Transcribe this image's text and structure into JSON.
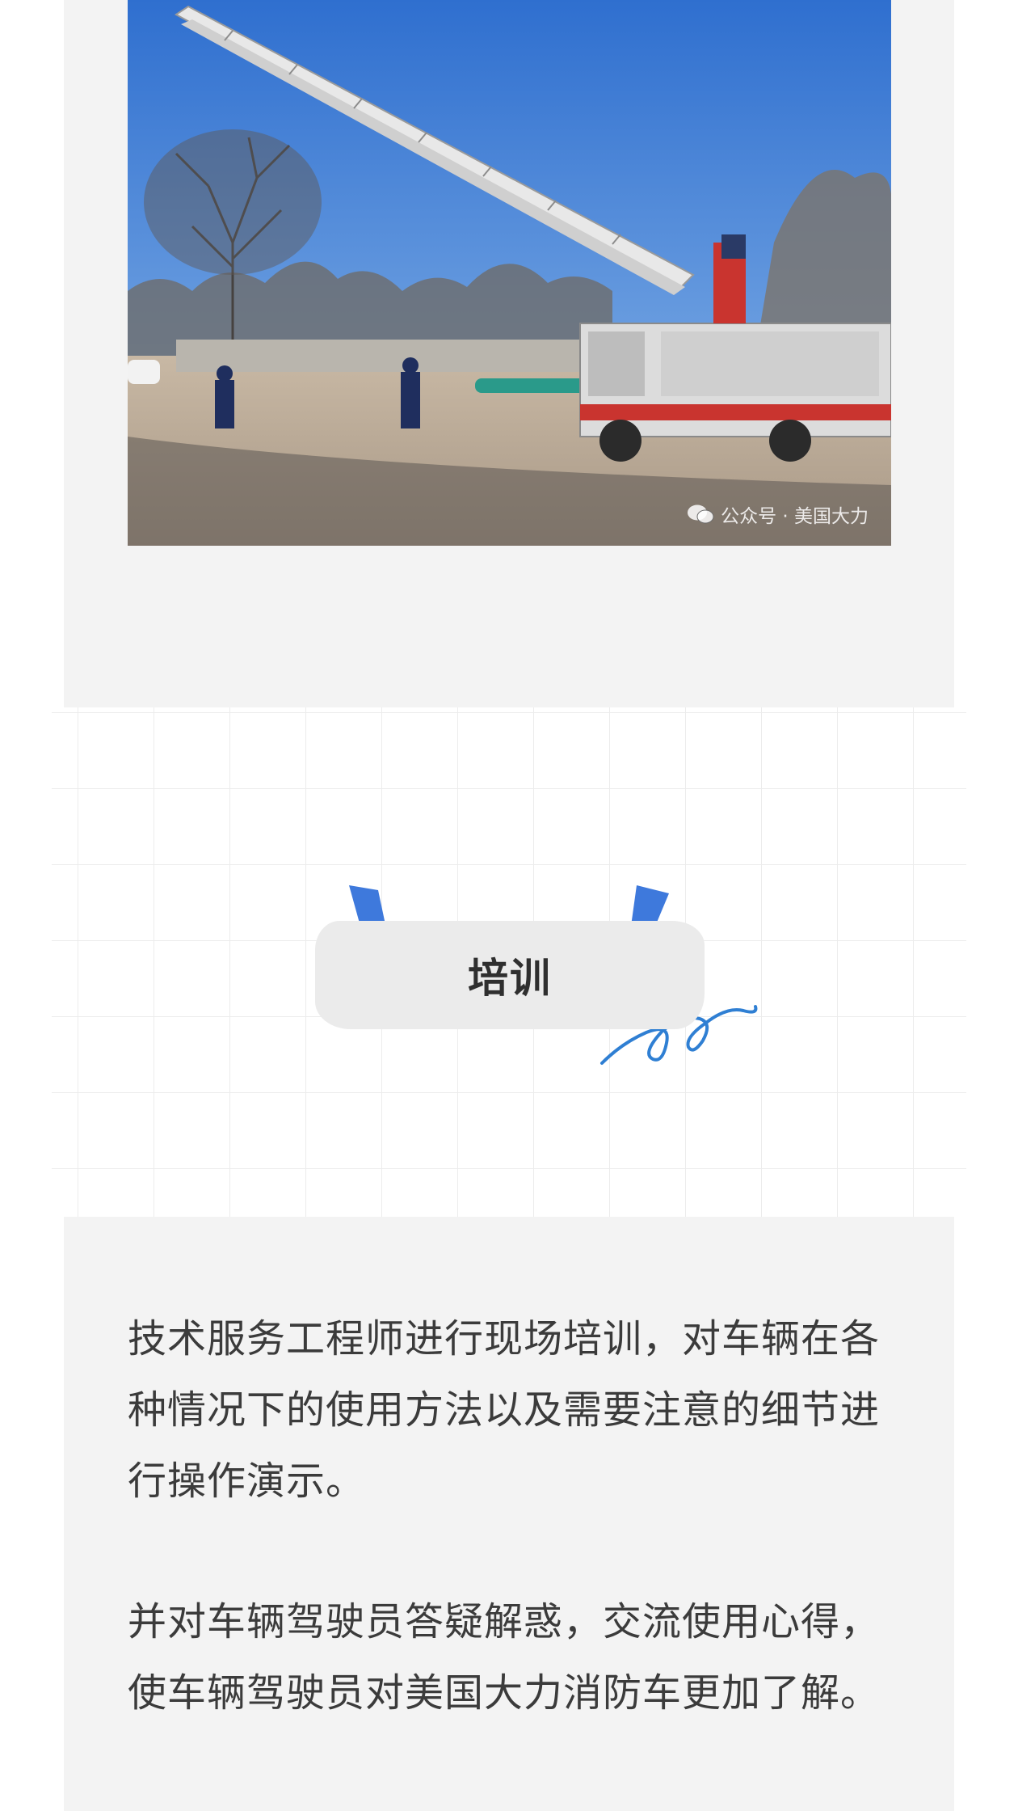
{
  "photo": {
    "watermark_text": "公众号 · 美国大力",
    "watermark_icon": "wechat-icon"
  },
  "section_tag": {
    "title": "培训",
    "accent_color": "#3e79dc",
    "scribble_color": "#2f7fd3"
  },
  "body": {
    "paragraphs": [
      "技术服务工程师进行现场培训，对车辆在各种情况下的使用方法以及需要注意的细节进行操作演示。",
      "并对车辆驾驶员答疑解惑，交流使用心得，使车辆驾驶员对美国大力消防车更加了解。"
    ]
  },
  "colors": {
    "card_background": "#f3f3f3",
    "text": "#3b3b3b",
    "tag_background": "#ebebeb"
  }
}
